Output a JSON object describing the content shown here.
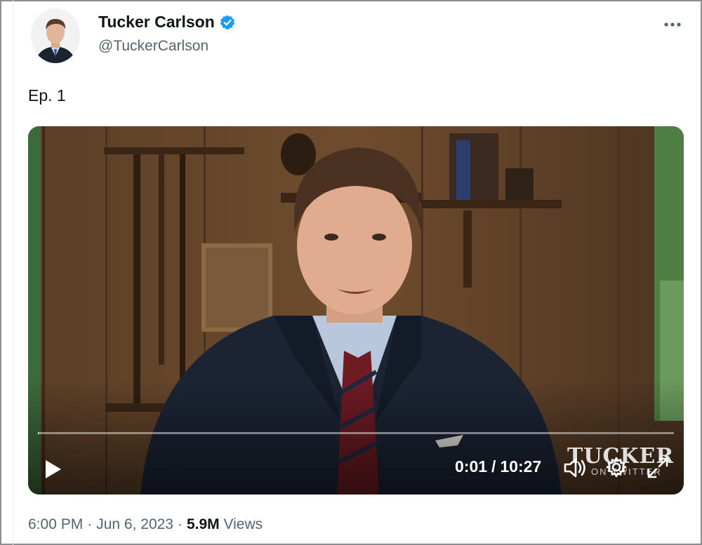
{
  "author": {
    "display_name": "Tucker Carlson",
    "handle": "@TuckerCarlson",
    "verified": true,
    "verified_color": "#1d9bf0"
  },
  "tweet": {
    "text": "Ep. 1",
    "time": "6:00 PM",
    "date": "Jun 6, 2023",
    "views_count": "5.9M",
    "views_label": "Views"
  },
  "more_icon": "ellipsis-icon",
  "video": {
    "current_time": "0:01",
    "duration": "10:27",
    "progress_fraction": 0.0016,
    "watermark_title": "TUCKER",
    "watermark_subtitle": "ON TWITTER",
    "icons": [
      "play-icon",
      "volume-icon",
      "settings-icon",
      "fullscreen-icon"
    ]
  }
}
